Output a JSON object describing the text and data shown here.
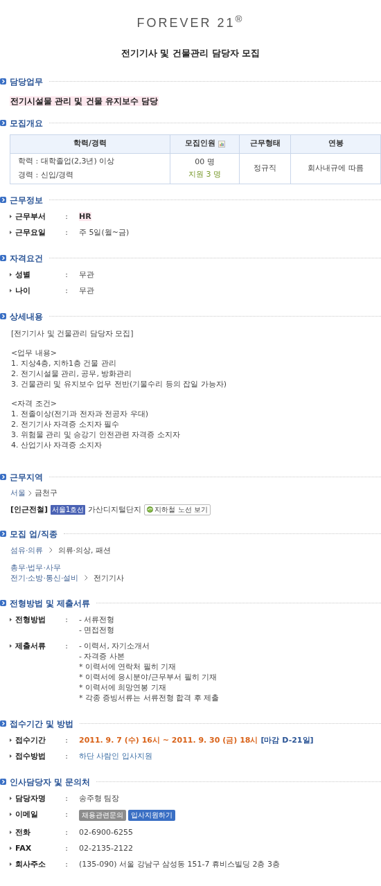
{
  "logo": "FOREVER 21$^{®}$",
  "title": "전기기사 및 건물관리 담당자 모집",
  "sections": [
    {
      "kind": "highlight",
      "heading": "담당업무",
      "text": "전기시설물 관리 및 건물 유지보수 담당"
    },
    {
      "kind": "table",
      "heading": "모집개요",
      "columns": [
        "학력/경력",
        "모집인원",
        "근무형태",
        "연봉"
      ],
      "row": {
        "career": [
          "학력 : 대학졸업(2,3년) 이상",
          "경력 : 신입/경력"
        ],
        "count": "00 명",
        "applied": "지원 3 명",
        "type": "정규직",
        "salary": "회사내규에 따름"
      }
    },
    {
      "kind": "fields",
      "heading": "근무정보",
      "fields": [
        {
          "kind": "bold",
          "label": "근무부서",
          "sep": ":",
          "lines": [
            "HR"
          ]
        },
        {
          "kind": "text",
          "label": "근무요일",
          "sep": ":",
          "lines": [
            "주 5일(월~금)"
          ]
        }
      ]
    },
    {
      "kind": "fields",
      "heading": "자격요건",
      "fields": [
        {
          "kind": "text",
          "label": "성별",
          "sep": ":",
          "lines": [
            "무관"
          ]
        },
        {
          "kind": "text",
          "label": "나이",
          "sep": ":",
          "lines": [
            "무관"
          ]
        }
      ]
    },
    {
      "kind": "detail",
      "heading": "상세내용",
      "paragraphs": [
        [
          "[전기기사 및 건물관리 담당자 모집]"
        ],
        [
          "<업무 내용>",
          "1. 지상4층, 지하1층 건물 관리",
          "2. 전기시설물 관리, 공무, 방화관리",
          "3. 건물관리 및 유지보수 업무 전반(기물수리 등의 잡일 가능자)"
        ],
        [
          "<자격 조건>",
          "1. 전졸이상(전기과 전자과 전공자 우대)",
          "2. 전기기사 자격증 소지자 필수",
          "3. 위험물 관리 및 승강기 안전관련 자격증 소지자",
          "4. 산업기사 자격증 소지자"
        ]
      ]
    },
    {
      "kind": "location",
      "heading": "근무지역",
      "region": [
        "서울",
        "금천구"
      ],
      "subway_label": "[인근전철]",
      "subway_line": "서울1호선",
      "station": "가산디지털단지",
      "map_button": "지하철 노선 보기"
    },
    {
      "kind": "jobs",
      "heading": "모집 업/직종",
      "groups": [
        [
          [
            "섬유·의류",
            "의류·의상, 패션"
          ]
        ],
        [
          [
            "총무·법무·사무"
          ],
          [
            "전기·소방·통신·설비",
            "전기기사"
          ]
        ]
      ]
    },
    {
      "kind": "fields",
      "heading": "전형방법 및 제출서류",
      "fields": [
        {
          "kind": "text",
          "label": "전형방법",
          "sep": ":",
          "lines": [
            "- 서류전형",
            "- 면접전형"
          ]
        },
        {
          "kind": "text",
          "label": "제출서류",
          "sep": ":",
          "lines": [
            "- 이력서, 자기소개서",
            "- 자격증 사본",
            "* 이력서에 연락처 필히 기재",
            "* 이력서에 응시분야/근무부서 필히 기재",
            "* 이력서에 희망연봉 기재",
            "* 각종 증빙서류는 서류전형 합격 후 제출"
          ]
        }
      ]
    },
    {
      "kind": "fields",
      "heading": "접수기간 및 방법",
      "fields": [
        {
          "kind": "date",
          "label": "접수기간",
          "sep": ":",
          "lines": [
            "2011. 9. 7 (수) 16시 ~ 2011. 9. 30 (금) 18시"
          ],
          "deadline": "[마감 D-21일]"
        },
        {
          "kind": "link",
          "label": "접수방법",
          "sep": ":",
          "lines": [
            "하단 사람인 입사지원"
          ]
        }
      ]
    },
    {
      "kind": "fields",
      "heading": "인사담당자 및 문의처",
      "fields": [
        {
          "kind": "text",
          "label": "담당자명",
          "sep": ":",
          "lines": [
            "송주형 팀장"
          ]
        },
        {
          "kind": "buttons",
          "label": "이메일",
          "sep": ":",
          "lines": [
            "채용관련문의",
            "입사지원하기"
          ]
        },
        {
          "kind": "text",
          "label": "전화",
          "sep": ":",
          "lines": [
            "02-6900-6255"
          ]
        },
        {
          "kind": "text",
          "label": "FAX",
          "sep": ":",
          "lines": [
            "02-2135-2122"
          ]
        },
        {
          "kind": "text",
          "label": "회사주소",
          "sep": ":",
          "lines": [
            "(135-090) 서울 강남구 삼성동 151-7 휴비스빌딩 2층 3층"
          ]
        }
      ]
    }
  ]
}
